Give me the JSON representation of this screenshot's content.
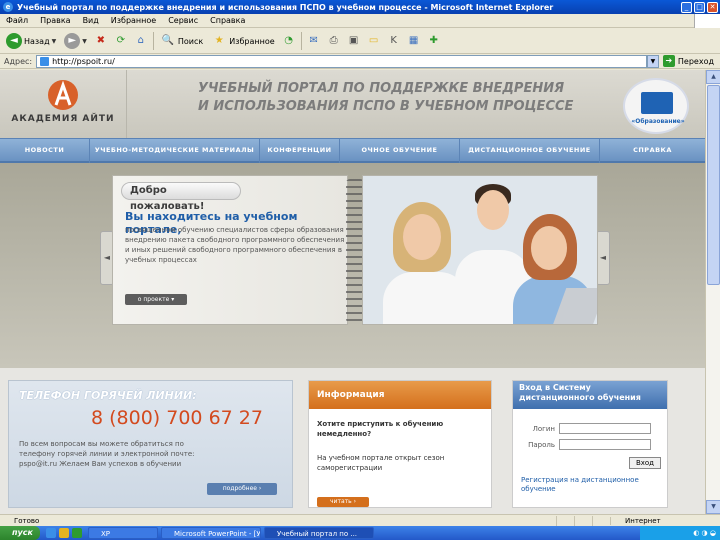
{
  "window": {
    "title": "Учебный портал по поддержке внедрения и использования ПСПО в учебном процессе - Microsoft Internet Explorer"
  },
  "menu": [
    "Файл",
    "Правка",
    "Вид",
    "Избранное",
    "Сервис",
    "Справка"
  ],
  "toolbar": {
    "back_label": "Назад",
    "search_label": "Поиск",
    "favorites_label": "Избранное"
  },
  "address": {
    "label": "Адрес:",
    "url": "http://pspoit.ru/",
    "go_label": "Переход"
  },
  "site": {
    "logo_text": "АКАДЕМИЯ АЙТИ",
    "title_line1": "УЧЕБНЫЙ ПОРТАЛ ПО ПОДДЕРЖКЕ ВНЕДРЕНИЯ",
    "title_line2": "И ИСПОЛЬЗОВАНИЯ ПСПО В УЧЕБНОМ ПРОЦЕССЕ",
    "badge_text": "«Образование»"
  },
  "nav": [
    "НОВОСТИ",
    "УЧЕБНО-МЕТОДИЧЕСКИЕ МАТЕРИАЛЫ",
    "КОНФЕРЕНЦИИ",
    "ОЧНОЕ ОБУЧЕНИЕ",
    "ДИСТАНЦИОННОЕ ОБУЧЕНИЕ",
    "СПРАВКА"
  ],
  "hero": {
    "welcome": "Добро пожаловать!",
    "heading": "Вы находитесь на учебном портале,",
    "paragraph": "посвященном обучению специалистов сферы образования внедрению пакета свободного программного обеспечения и иных решений свободного программного обеспечения в учебных процессах",
    "about_button": "о проекте"
  },
  "hotline": {
    "label": "ТЕЛЕФОН ГОРЯЧЕЙ ЛИНИИ:",
    "phone": "8 (800) 700 67 27",
    "text": "По всем вопросам вы можете обратиться по телефону горячей линии и электронной почте: pspo@it.ru Желаем Вам успехов в обучении",
    "more_button": "подробнее"
  },
  "info": {
    "title": "Информация",
    "question": "Хотите приступить к обучению немедленно?",
    "answer": "На учебном портале открыт сезон саморегистрации",
    "read_button": "читать"
  },
  "login": {
    "title": "Вход в Систему дистанционного обучения",
    "login_label": "Логин",
    "password_label": "Пароль",
    "enter_button": "Вход",
    "register_link": "Регистрация на дистанционное обучение"
  },
  "status": {
    "text": "Готово",
    "zone": "Интернет"
  },
  "taskbar": {
    "start": "пуск",
    "tasks": [
      "ХР",
      "Microsoft PowerPoint - [У...",
      "Учебный портал по ..."
    ]
  }
}
